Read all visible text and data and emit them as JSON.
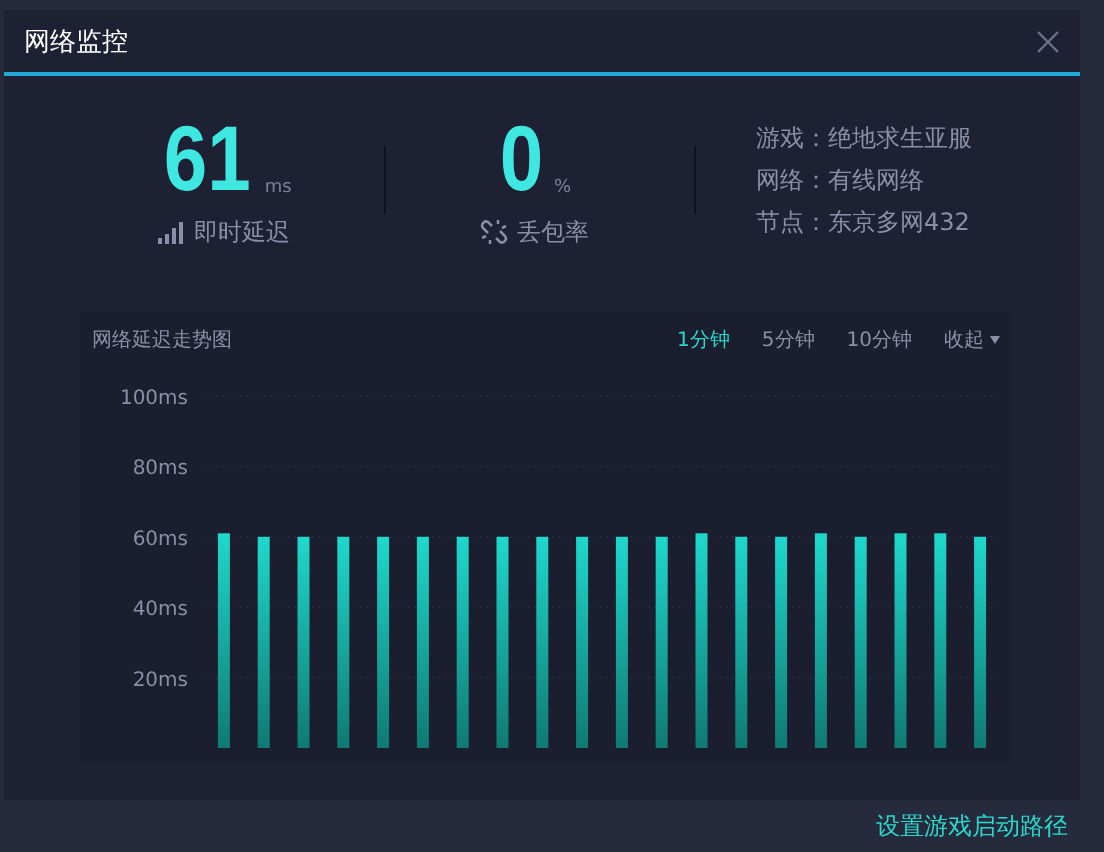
{
  "window": {
    "title": "网络监控"
  },
  "stats": [
    {
      "value": "61",
      "unit": "ms",
      "label": "即时延迟",
      "kind": "latency"
    },
    {
      "value": "0",
      "unit": "%",
      "label": "丢包率",
      "kind": "loss"
    }
  ],
  "info": [
    "游戏：绝地求生亚服",
    "网络：有线网络",
    "节点：东京多网432"
  ],
  "chart_panel": {
    "title": "网络延迟走势图",
    "tabs": [
      {
        "label": "1分钟",
        "selected": true
      },
      {
        "label": "5分钟",
        "selected": false
      },
      {
        "label": "10分钟",
        "selected": false
      }
    ],
    "collapse": "收起",
    "chart_data": {
      "type": "bar",
      "grid": true,
      "series": [
        {
          "color": "#1fd8cc",
          "values": [
            61,
            60,
            60,
            60,
            60,
            60,
            60,
            60,
            60,
            60,
            60,
            60,
            61,
            60,
            60,
            61,
            60,
            61,
            61,
            60
          ]
        }
      ],
      "ylim": [
        0,
        100
      ],
      "yticks": [
        {
          "value": 20,
          "label": "20ms"
        },
        {
          "value": 40,
          "label": "40ms"
        },
        {
          "value": 60,
          "label": "60ms"
        },
        {
          "value": 80,
          "label": "80ms"
        },
        {
          "value": 100,
          "label": "100ms"
        }
      ]
    }
  },
  "footer_link": "设置游戏启动路径"
}
